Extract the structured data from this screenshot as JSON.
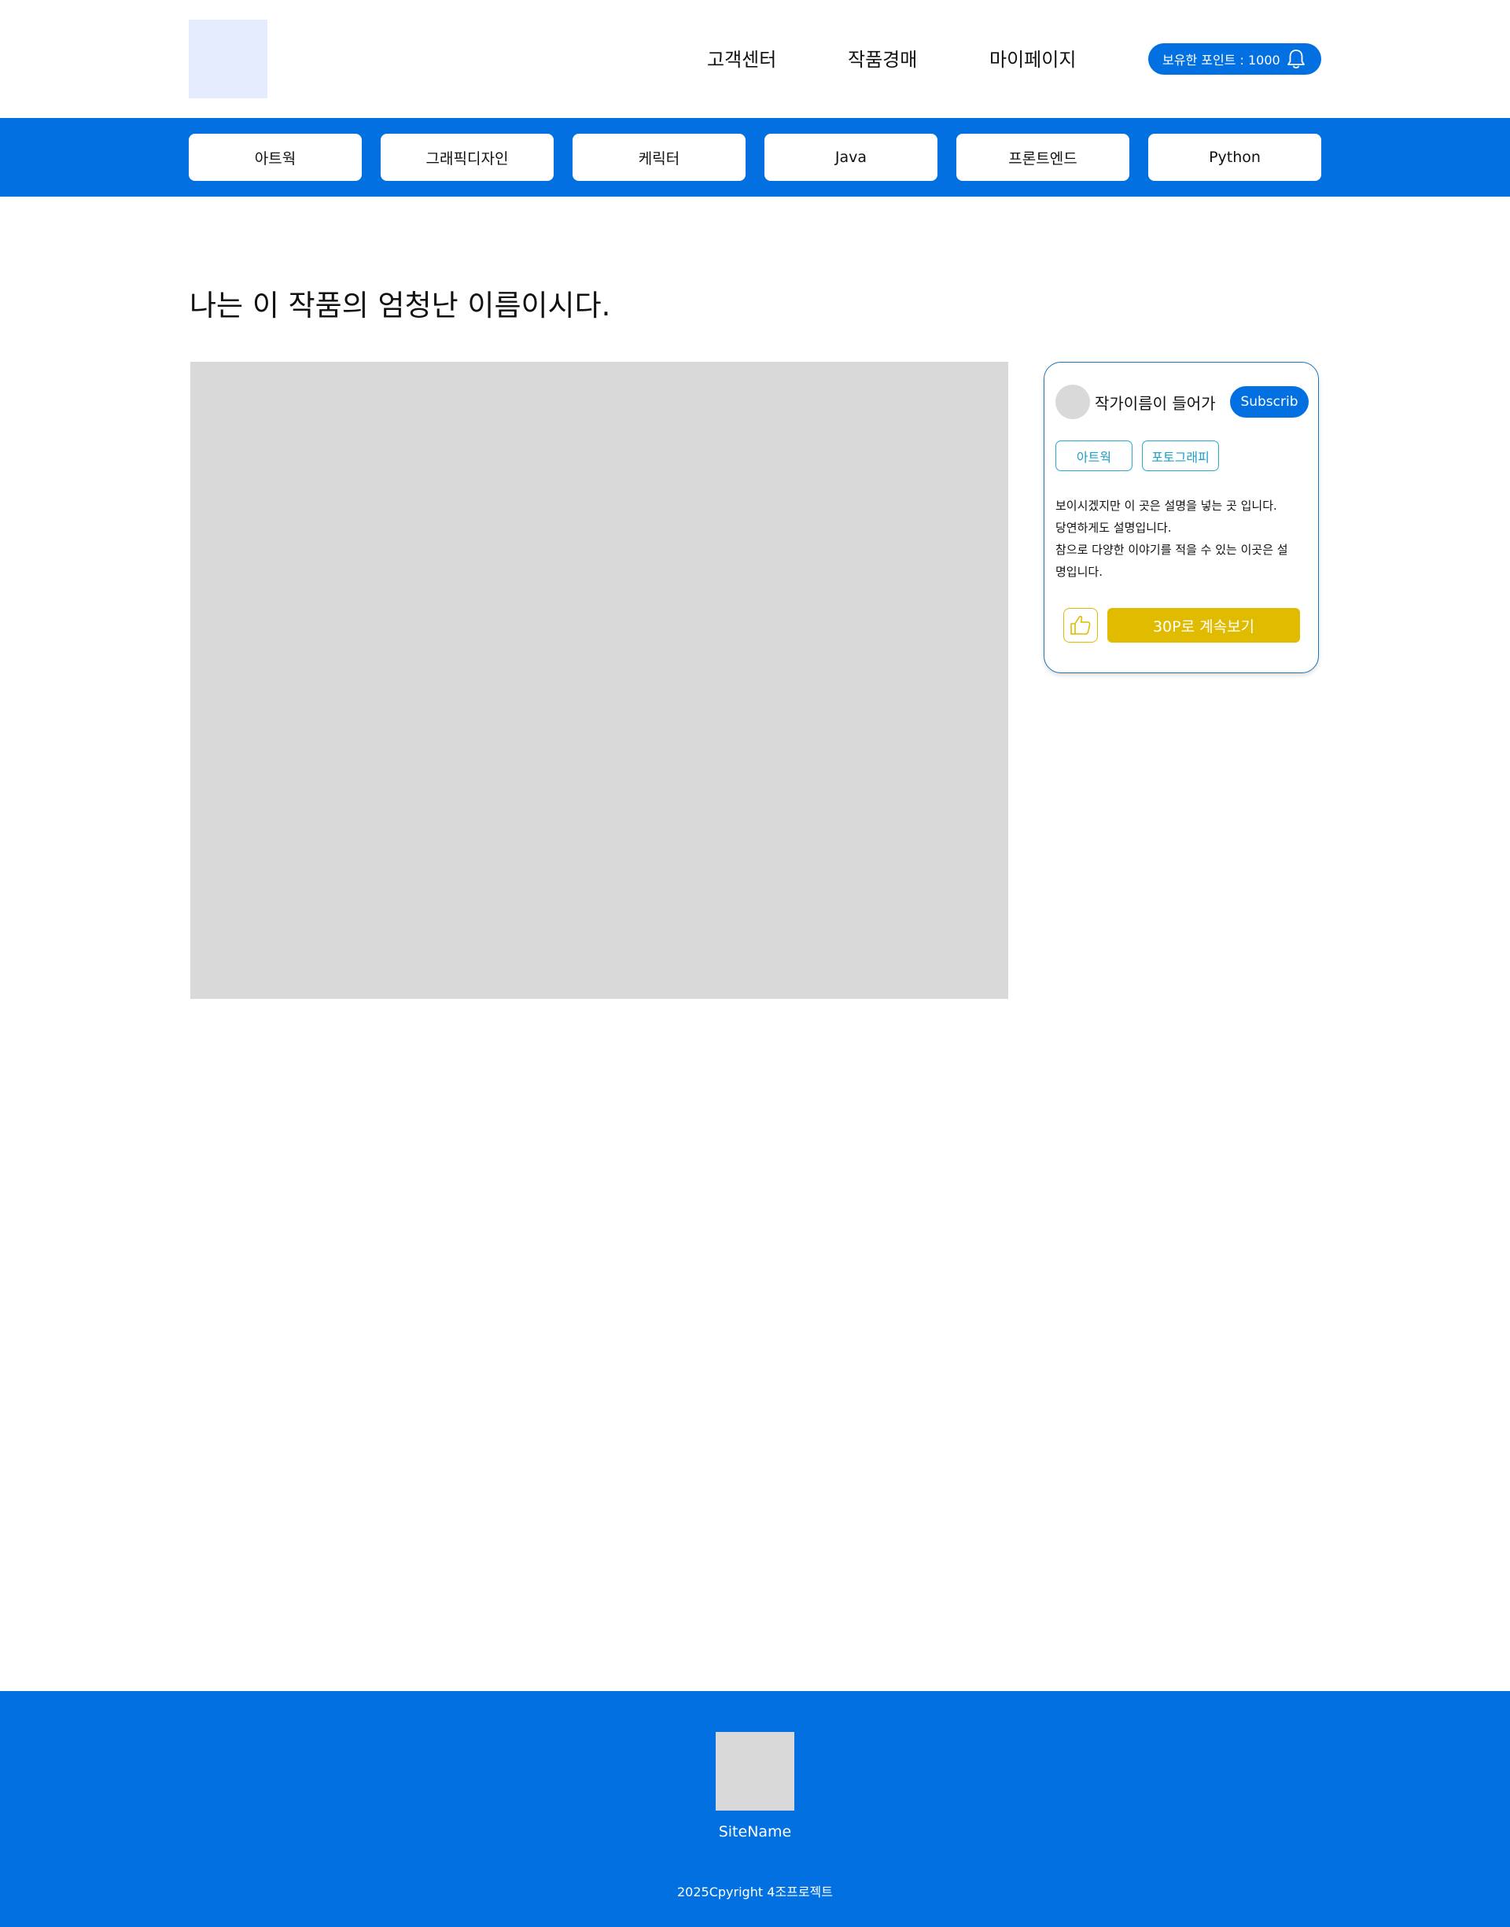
{
  "header": {
    "nav": [
      "고객센터",
      "작품경매",
      "마이페이지"
    ],
    "points_label": "보유한 포인트 : 1000",
    "bell_icon": "bell-icon"
  },
  "categories": [
    "아트웍",
    "그래픽디자인",
    "케릭터",
    "Java",
    "프론트엔드",
    "Python"
  ],
  "main": {
    "title": "나는 이 작품의 엄청난 이름이시다."
  },
  "card": {
    "author": "작가이름이 들어가",
    "subscribe": "Subscrib",
    "tags": [
      "아트웍",
      "포토그래피"
    ],
    "description": [
      "보이시겠지만 이 곳은 설명을 넣는 곳 입니다.",
      "당연하게도 설명입니다.",
      "참으로 다양한 이야기를 적을 수 있는 이곳은 설",
      "명입니다."
    ],
    "like_icon": "thumbs-up-icon",
    "continue_label": "30P로 계속보기"
  },
  "footer": {
    "site_name": "SiteName",
    "copyright": "2025Cpyright 4조프로젝트"
  },
  "colors": {
    "primary": "#0270e0",
    "accent": "#e0bb00",
    "tag": "#29a9cf",
    "placeholder": "#d9d9d9",
    "logo_bg": "#e5ecfd"
  }
}
